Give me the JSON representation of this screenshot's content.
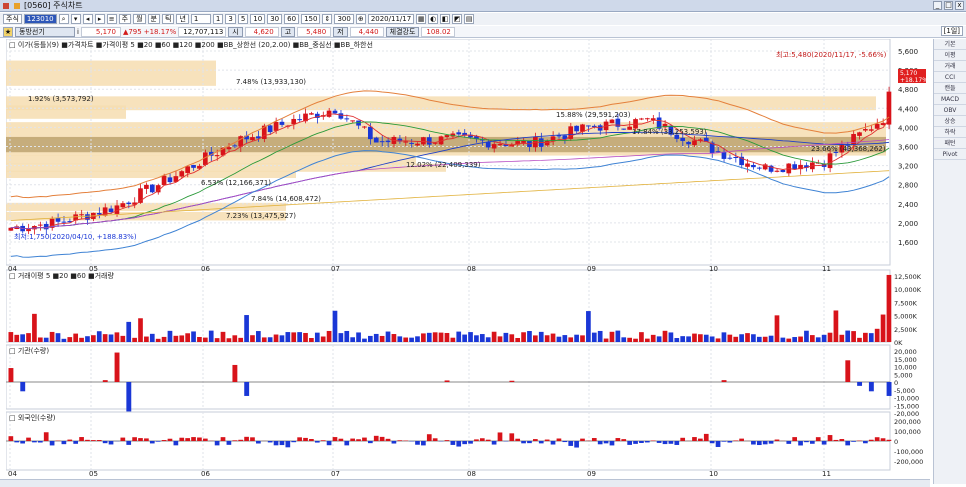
{
  "window": {
    "title": "[0560] 주식차트",
    "buttons": [
      "_",
      "□",
      "x"
    ]
  },
  "toolbar1": {
    "market": "주식",
    "code": "123010",
    "period_tabs": [
      "주",
      "월",
      "분",
      "틱",
      "년"
    ],
    "period_value": "1",
    "minute_opts": [
      "1",
      "3",
      "5",
      "10",
      "30",
      "60"
    ],
    "count": "150",
    "count2": "300",
    "date": "2020/11/17"
  },
  "toolbar2": {
    "name": "동방선기",
    "info_icon": "i",
    "price": "5,170",
    "change": "▲795",
    "pct": "+18.17%",
    "volume": "12,707,113",
    "open_lbl": "시",
    "open": "4,620",
    "high_lbl": "고",
    "high": "5,480",
    "low_lbl": "저",
    "low": "4,440",
    "strength_lbl": "체결강도",
    "strength": "108.02",
    "unit": "[1일]"
  },
  "legend": {
    "main": "□ 이가(등틀)(9)",
    "chart": "■가격차트",
    "ma": "■가격이평 5 ■20 ■60 ■120 ■200",
    "bb_upper": "■BB_상한선 (20,2.00)",
    "bb_mid": "■BB_중심선",
    "bb_lower": "■BB_하한선"
  },
  "vol_legend": "□ 거래이평 5 ■20 ■60 ■거래량",
  "inst_legend": "□ 기관(수량)",
  "for_legend": "□ 외국인(수량)",
  "annotations": {
    "high": "최고:5,480(2020/11/17, -5.66%)",
    "low": "최저:1,750(2020/04/10, +188.83%)",
    "cur1": "5,170",
    "cur2": "+18.17%"
  },
  "vp_labels": [
    "7.48% (13,933,130)",
    "1.92% (3,573,792)",
    "15.88% (29,591,203)",
    "17.84% (33,253,593)",
    "6.53% (12,166,371)",
    "12.02% (22,409,339)",
    "7.84% (14,608,472)",
    "7.23% (13,475,927)",
    "23.66% (43,368,262)"
  ],
  "price_ticks": [
    "5,600",
    "5,200",
    "4,800",
    "4,400",
    "4,000",
    "3,600",
    "3,200",
    "2,800",
    "2,400",
    "2,000",
    "1,600"
  ],
  "vol_ticks": [
    "12,500K",
    "10,000K",
    "7,500K",
    "5,000K",
    "2,500K",
    "0K"
  ],
  "inst_ticks": [
    "20,000",
    "15,000",
    "10,000",
    "5,000",
    "0",
    "-5,000",
    "-10,000",
    "-15,000",
    "-20,000"
  ],
  "for_ticks": [
    "200,000",
    "100,000",
    "0",
    "-100,000",
    "-200,000"
  ],
  "months": [
    "04",
    "05",
    "06",
    "07",
    "08",
    "09",
    "10",
    "11"
  ],
  "right_tools": [
    "기본",
    "이평",
    "거래",
    "CCI",
    "캔들",
    "MACD",
    "OBV",
    "상승",
    "하락",
    "패턴",
    "Pivot"
  ],
  "colors": {
    "up": "#d8131a",
    "down": "#1a37d6",
    "bb_upper": "#e4803c",
    "bb_mid": "#2b9a3a",
    "bb_lower": "#3f83d4",
    "vp": "#f6ddb0",
    "vp_dark": "#a58a52"
  }
}
